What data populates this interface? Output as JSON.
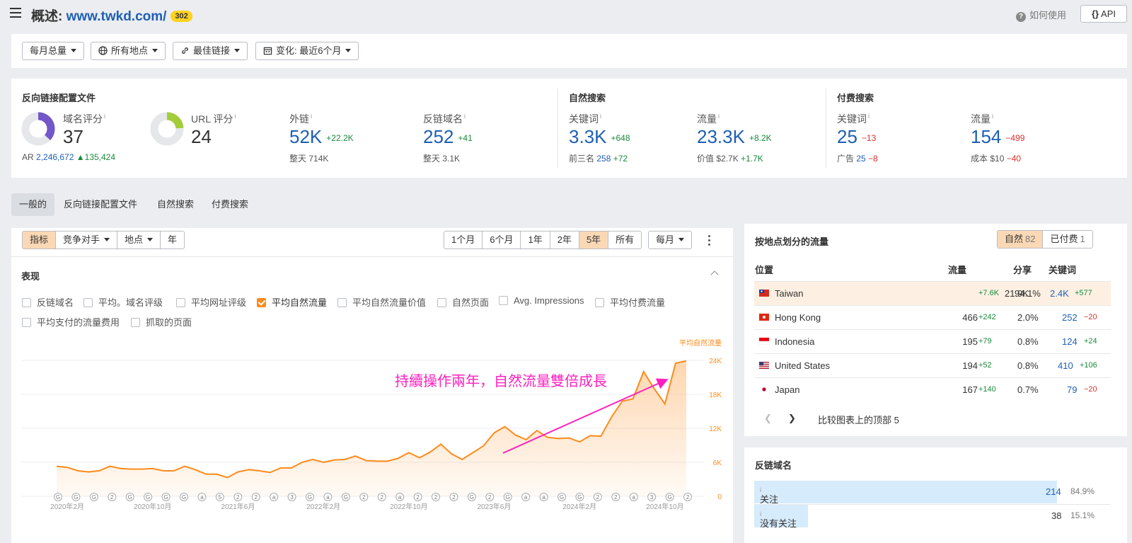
{
  "header": {
    "title_prefix": "概述: ",
    "domain": "www.twkd.com/",
    "badge": "302",
    "help": "如何使用",
    "api": "API"
  },
  "filters": {
    "volume": "每月总量",
    "location": "所有地点",
    "links": "最佳链接",
    "change": "变化: 最近6个月"
  },
  "stats": {
    "backlink_profile": {
      "heading": "反向链接配置文件",
      "dr_label": "域名评分",
      "dr_value": "37",
      "dr_fraction": 0.37,
      "ar_label": "AR",
      "ar_value": "2,246,672",
      "ar_delta": "135,424",
      "ur_label": "URL 评分",
      "ur_value": "24",
      "ur_fraction": 0.24,
      "backlinks_label": "外链",
      "backlinks_value": "52K",
      "backlinks_delta": "+22.2K",
      "backlinks_sub_label": "整天",
      "backlinks_sub_value": "714K",
      "refdomains_label": "反链域名",
      "refdomains_value": "252",
      "refdomains_delta": "+41",
      "refdomains_sub_label": "整天",
      "refdomains_sub_value": "3.1K"
    },
    "organic": {
      "heading": "自然搜索",
      "kw_label": "关键词",
      "kw_value": "3.3K",
      "kw_delta": "+648",
      "top3_label": "前三名",
      "top3_value": "258",
      "top3_delta": "+72",
      "traffic_label": "流量",
      "traffic_value": "23.3K",
      "traffic_delta": "+8.2K",
      "value_label": "价值",
      "value_value": "$2.7K",
      "value_delta": "+1.7K"
    },
    "paid": {
      "heading": "付费搜索",
      "kw_label": "关键词",
      "kw_value": "25",
      "kw_delta": "−13",
      "ads_label": "广告",
      "ads_value": "25",
      "ads_delta": "−8",
      "traffic_label": "流量",
      "traffic_value": "154",
      "traffic_delta": "−499",
      "cost_label": "成本",
      "cost_value": "$10",
      "cost_delta": "−40"
    }
  },
  "tabs": [
    "一般的",
    "反向链接配置文件",
    "自然搜索",
    "付费搜索"
  ],
  "chart_controls": {
    "left": [
      "指标",
      "竞争对手",
      "地点",
      "年"
    ],
    "ranges": [
      "1个月",
      "6个月",
      "1年",
      "2年",
      "5年",
      "所有"
    ],
    "active_range": "5年",
    "interval": "每月",
    "section_title": "表现"
  },
  "metrics": [
    {
      "label": "反链域名",
      "checked": false
    },
    {
      "label": "平均。域名评级",
      "checked": false
    },
    {
      "label": "平均网址评级",
      "checked": false
    },
    {
      "label": "平均自然流量",
      "checked": true
    },
    {
      "label": "平均自然流量价值",
      "checked": false
    },
    {
      "label": "自然页面",
      "checked": false
    },
    {
      "label": "Avg. Impressions",
      "checked": false
    },
    {
      "label": "平均付费流量",
      "checked": false
    },
    {
      "label": "平均支付的流量费用",
      "checked": false
    },
    {
      "label": "抓取的页面",
      "checked": false
    }
  ],
  "annotation": "持續操作兩年，自然流量雙倍成長",
  "chart_data": {
    "type": "area",
    "series": [
      {
        "name": "平均自然流量",
        "color": "#ff8a1a",
        "values": [
          5300,
          5100,
          4500,
          4300,
          4500,
          5300,
          4900,
          4800,
          4800,
          4900,
          4500,
          4500,
          5300,
          4700,
          3900,
          3900,
          3300,
          4300,
          4700,
          4500,
          4200,
          5000,
          5000,
          6000,
          6500,
          6000,
          6400,
          6500,
          7100,
          6300,
          6200,
          6200,
          6700,
          7700,
          6800,
          7800,
          9200,
          7500,
          6500,
          7700,
          8900,
          11200,
          12300,
          10800,
          10000,
          11600,
          10400,
          10200,
          10300,
          9600,
          10700,
          10600,
          14000,
          16800,
          17200,
          22000,
          19000,
          16300,
          23500,
          23900
        ]
      }
    ],
    "x_tick_labels": [
      "2020年2月",
      "2020年10月",
      "2021年6月",
      "2022年2月",
      "2022年10月",
      "2023年6月",
      "2024年2月",
      "2024年10月"
    ],
    "y_tick_labels": [
      "0",
      "6K",
      "12K",
      "18K",
      "24K"
    ],
    "ylim": [
      0,
      25000
    ],
    "y_axis_title": "平均自然流量",
    "event_markers": [
      "G",
      "G",
      "G",
      "2",
      "G",
      "G",
      "G",
      "G",
      "a",
      "5",
      "2",
      "2",
      "a",
      "3",
      "G",
      "a",
      "G",
      "2",
      "2",
      "a",
      "2",
      "2",
      "2",
      "G",
      "2",
      "G",
      "a",
      "a",
      "G",
      "G",
      "2",
      "2",
      "a",
      "3",
      "G",
      "2"
    ]
  },
  "geo": {
    "title": "按地点划分的流量",
    "organic_label": "自然",
    "organic_count": "82",
    "paid_label": "已付费",
    "paid_count": "1",
    "columns": [
      "位置",
      "流量",
      "分享",
      "关键词"
    ],
    "rows": [
      {
        "country": "Taiwan",
        "traffic": "21.9K",
        "traffic_delta": "+7.6K",
        "share": "94.1%",
        "keywords": "2.4K",
        "kw_delta": "+577"
      },
      {
        "country": "Hong Kong",
        "traffic": "466",
        "traffic_delta": "+242",
        "share": "2.0%",
        "keywords": "252",
        "kw_delta": "−20"
      },
      {
        "country": "Indonesia",
        "traffic": "195",
        "traffic_delta": "+79",
        "share": "0.8%",
        "keywords": "124",
        "kw_delta": "+24"
      },
      {
        "country": "United States",
        "traffic": "194",
        "traffic_delta": "+52",
        "share": "0.8%",
        "keywords": "410",
        "kw_delta": "+106"
      },
      {
        "country": "Japan",
        "traffic": "167",
        "traffic_delta": "+140",
        "share": "0.7%",
        "keywords": "79",
        "kw_delta": "−20"
      }
    ],
    "compare": "比较图表上的顶部 5"
  },
  "refdomains": {
    "title": "反链域名",
    "rows": [
      {
        "label": "关注",
        "value": "214",
        "pct": "84.9%",
        "fraction": 0.849
      },
      {
        "label": "没有关注",
        "value": "38",
        "pct": "15.1%",
        "fraction": 0.151
      }
    ]
  }
}
